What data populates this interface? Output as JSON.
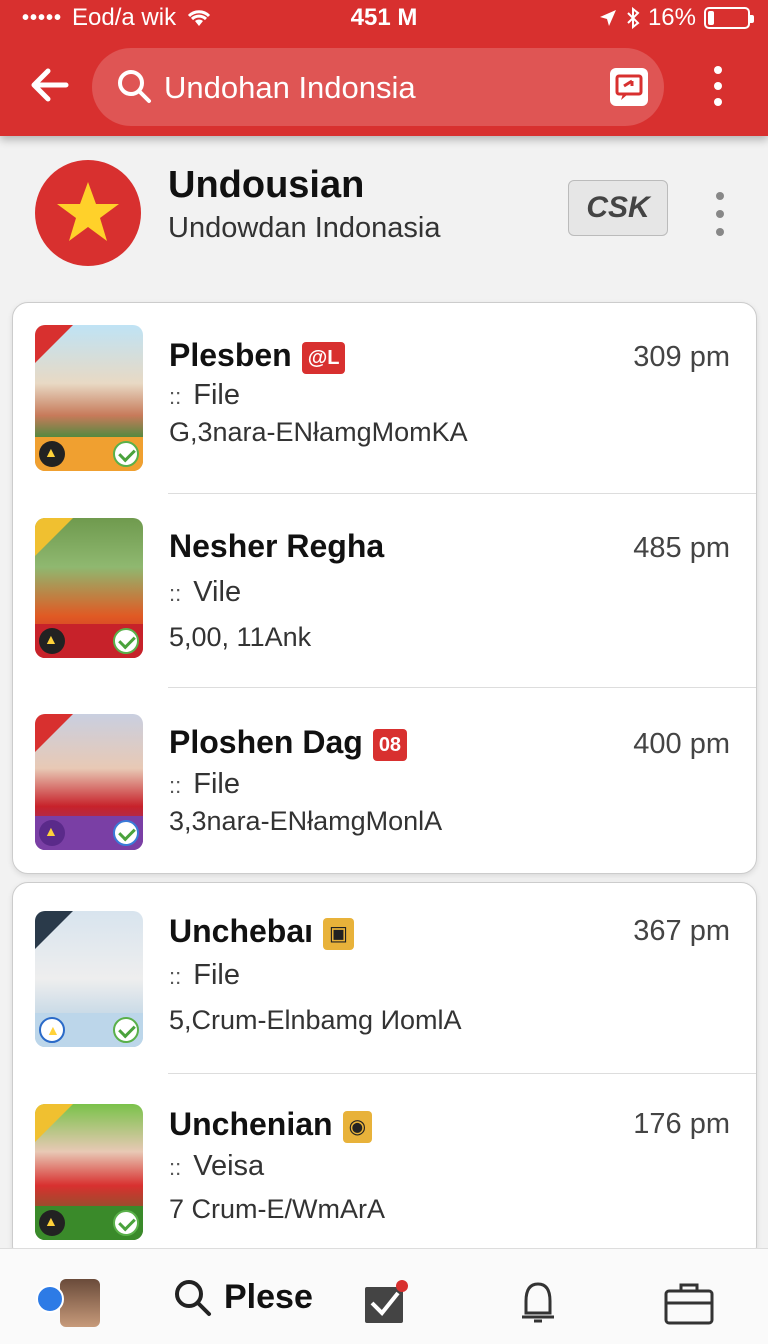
{
  "status_bar": {
    "dots": "•••••",
    "carrier": "Eod/a wik",
    "center": "451 M",
    "battery_text": "16%",
    "battery_level": 0.16
  },
  "app_bar": {
    "search_value": "Undohan Indonsia"
  },
  "channel": {
    "name": "Undousian",
    "subtitle": "Undowdan Indonasia",
    "action_label": "CSK"
  },
  "items": [
    {
      "title": "Plesben",
      "badge": "@L",
      "badge_color": "#d8302f",
      "type": "File",
      "meta": "G,3nara-ENłamgMomKA",
      "time": "309 pm"
    },
    {
      "title": "Nesher Regha",
      "badge": "",
      "badge_color": "",
      "type": "Vile",
      "meta": "5,00,  11Ank",
      "time": "485 pm"
    },
    {
      "title": "Ploshen Dag",
      "badge": "08",
      "badge_color": "#d8302f",
      "type": "File",
      "meta": "3,3nara-ENłamgMonlA",
      "time": "400 pm"
    },
    {
      "title": "Unchebaı",
      "badge": "▣",
      "badge_color": "#e8b23a",
      "type": "File",
      "meta": "5,Crum-Elnbamg ИomlA",
      "time": "367 pm"
    },
    {
      "title": "Unchenian",
      "badge": "◉",
      "badge_color": "#e8b23a",
      "type": "Veisa",
      "meta": "7 Crum-E/WmArA",
      "time": "176 pm"
    }
  ],
  "bottom_nav": {
    "search_label": "Plese"
  },
  "colors": {
    "brand_red": "#d8302f",
    "check_green": "#5ab04a"
  }
}
